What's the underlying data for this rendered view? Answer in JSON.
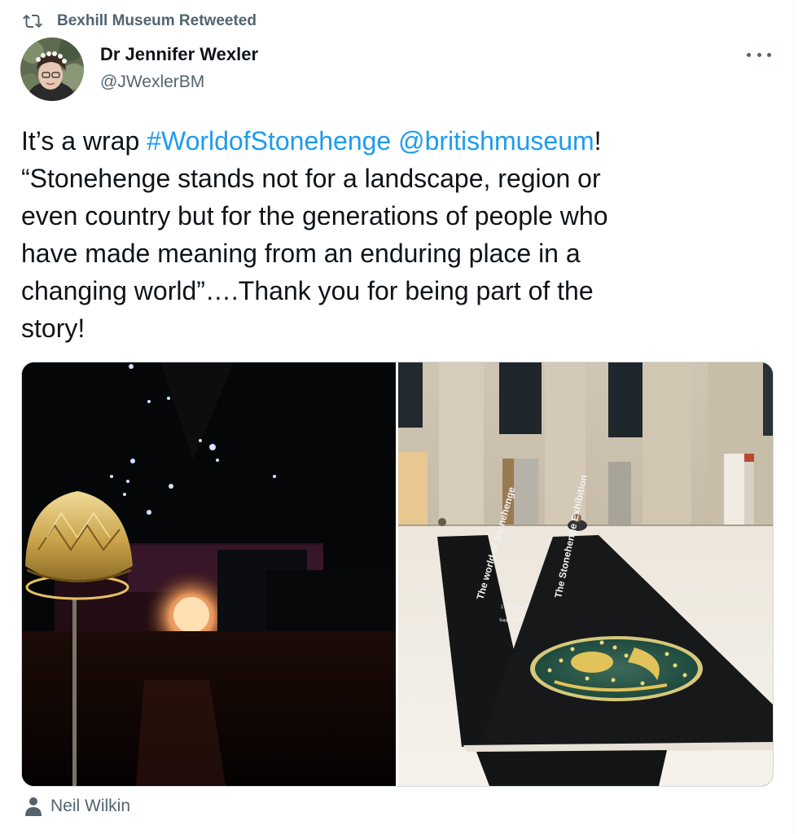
{
  "retweet": {
    "icon": "retweet-icon",
    "text": "Bexhill Museum Retweeted"
  },
  "author": {
    "name": "Dr Jennifer Wexler",
    "handle": "@JWexlerBM",
    "avatar_icon": "avatar"
  },
  "more_icon": "more-icon",
  "tweet": {
    "line1_pre": "It’s a wrap ",
    "hashtag": "#WorldofStonehenge",
    "line1_mid": " ",
    "mention": "@britishmuseum",
    "line1_post": "!",
    "line2": "“Stonehenge stands not for a landscape, region or",
    "line3": "even country but for the generations of people who",
    "line4": "have made meaning from an enduring place in a",
    "line5": "changing world”….Thank you for being part of the",
    "line6": "story!"
  },
  "media": {
    "banner_left": "The world of Stonehenge",
    "banner_right": "The Stonehenge Exhibition",
    "banner_date": "17 February",
    "banner_support": "Supported by"
  },
  "tagged": {
    "icon": "person-icon",
    "name": "Neil Wilkin"
  },
  "colors": {
    "link": "#1d9bf0",
    "secondary_text": "#536471",
    "primary_text": "#0f1419"
  }
}
